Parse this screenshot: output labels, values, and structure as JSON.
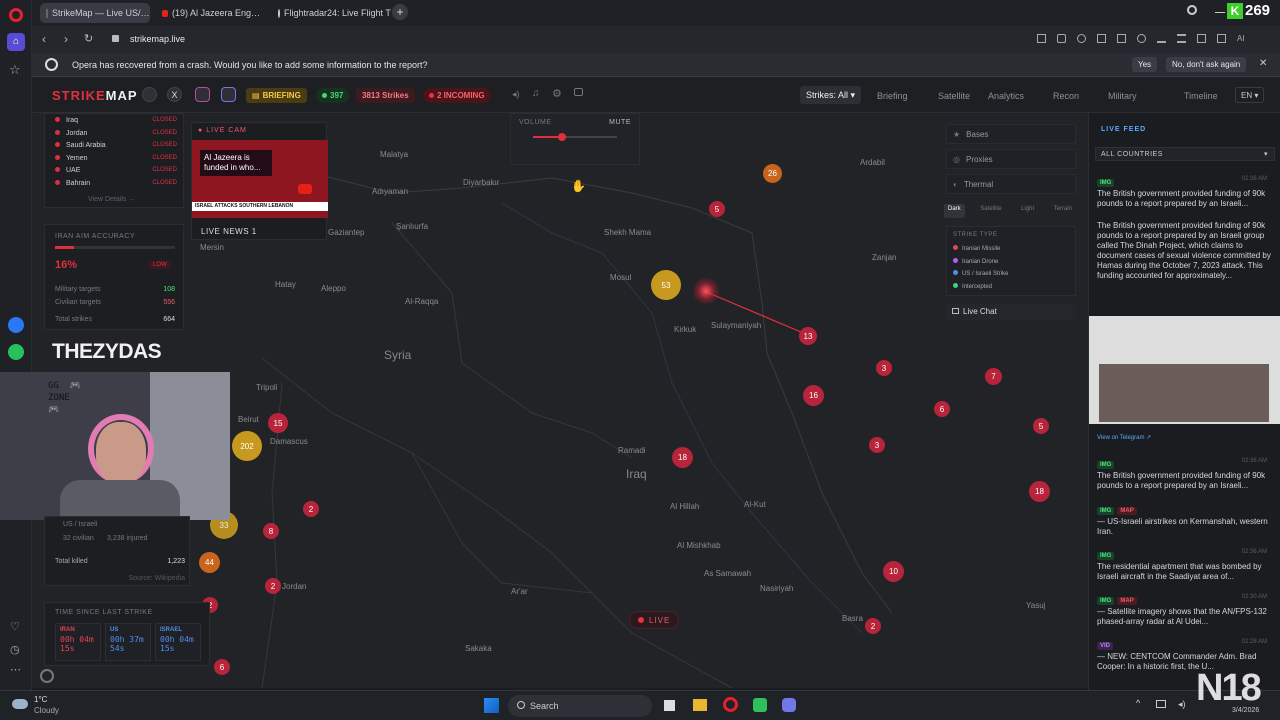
{
  "browser": {
    "tabs": [
      "StrikeMap — Live US/…",
      "(19) Al Jazeera Eng…",
      "Flightradar24: Live Flight T…"
    ],
    "url": "strikemap.live",
    "crash_message": "Opera has recovered from a crash. Would you like to add some information to the report?",
    "crash_yes": "Yes",
    "crash_no": "No, don't ask again",
    "badge_count": "269"
  },
  "header": {
    "logo_a": "STRIKE",
    "logo_b": "MAP",
    "briefing": "BRIEFING",
    "online_count": "397",
    "strikes_count": "3813 Strikes",
    "incoming": "2 INCOMING",
    "nav": [
      "Strikes: All",
      "Briefing",
      "Satellite",
      "Analytics",
      "Recon",
      "Military",
      "Timeline"
    ],
    "lang": "EN"
  },
  "countries_list": [
    {
      "name": "Iraq",
      "status": "CLOSED"
    },
    {
      "name": "Jordan",
      "status": "CLOSED"
    },
    {
      "name": "Saudi Arabia",
      "status": "CLOSED"
    },
    {
      "name": "Yemen",
      "status": "CLOSED"
    },
    {
      "name": "UAE",
      "status": "CLOSED"
    },
    {
      "name": "Bahrain",
      "status": "CLOSED"
    }
  ],
  "view_details": "View Details →",
  "accuracy": {
    "title": "IRAN AIM ACCURACY",
    "percent": "16%",
    "rating": "LOW",
    "military_label": "Military targets",
    "military": "108",
    "civilian_label": "Civilian targets",
    "civilian": "556",
    "total_label": "Total strikes",
    "total": "664",
    "fill": 0.16
  },
  "watermark": "THEZYDAS",
  "casualties": {
    "us_israel": "US / Israeli",
    "civilian": "32 civilian",
    "injured": "3,238 injured",
    "killed_label": "Total killed",
    "killed": "1,223",
    "source": "Source: Wikipedia"
  },
  "timers": {
    "title": "TIME SINCE LAST STRIKE",
    "items": [
      {
        "label": "IRAN",
        "line1": "00h 04m",
        "line2": "15s",
        "color": "#e2454f"
      },
      {
        "label": "US",
        "line1": "00h 37m",
        "line2": "54s",
        "color": "#4f8fe8"
      },
      {
        "label": "ISRAEL",
        "line1": "00h 04m",
        "line2": "15s",
        "color": "#4f8fe8"
      }
    ]
  },
  "live_cam": {
    "label": "LIVE CAM",
    "headline": "Al Jazeera is funded in who...",
    "ticker": "ISRAEL ATTACKS SOUTHERN LEBANON",
    "news": "LIVE NEWS 1"
  },
  "volume": {
    "label": "VOLUME",
    "mute": "MUTE",
    "level": 0.3
  },
  "map": {
    "countries": [
      "Syria",
      "Iraq"
    ],
    "cities": [
      "Malatya",
      "Adıyaman",
      "Diyarbakır",
      "Ardabil",
      "Şanlıurfa",
      "Gaziantep",
      "Mersin",
      "Shekh Mama",
      "Zanjan",
      "Mosul",
      "Hatay",
      "Aleppo",
      "Al-Raqqa",
      "Kirkuk",
      "Sulaymaniyah",
      "Tripoli",
      "Beirut",
      "Damascus",
      "Ramadi",
      "Al Hillah",
      "Al-Kut",
      "Al Mishkhab",
      "As Samawah",
      "Nasiriyah",
      "Jordan",
      "Ar'ar",
      "Basra",
      "Sakaka",
      "Yasuj"
    ],
    "markers": [
      "26",
      "5",
      "53",
      "13",
      "3",
      "7",
      "16",
      "6",
      "15",
      "202",
      "3",
      "5",
      "18",
      "18",
      "2",
      "8",
      "2",
      "10",
      "44",
      "2",
      "6",
      "2",
      "33"
    ],
    "live": "LIVE"
  },
  "layers": {
    "items": [
      "Bases",
      "Proxies",
      "Thermal"
    ],
    "styles": [
      "Dark",
      "Satellite",
      "Light",
      "Terrain"
    ],
    "strike_type_title": "STRIKE TYPE",
    "strike_types": [
      {
        "name": "Iranian Missile",
        "color": "#e2454f"
      },
      {
        "name": "Iranian Drone",
        "color": "#b45ff0"
      },
      {
        "name": "US / Israeli Strike",
        "color": "#4f8fe8"
      },
      {
        "name": "Intercepted",
        "color": "#3ed07a"
      }
    ],
    "chat": "Live Chat"
  },
  "feed": {
    "title": "LIVE FEED",
    "filter": "ALL COUNTRIES",
    "times": [
      "02:36 AM",
      "02:36 AM",
      "02:36 AM",
      "02:30 AM",
      "02:28 AM"
    ],
    "short1": "The British government provided funding of 90k pounds to a report prepared by an Israeli...",
    "long1": "The British government provided funding of 90k pounds to a report prepared by an Israeli group called The Dinah Project, which claims to document cases of sexual violence committed by Hamas during the October 7, 2023 attack. This funding accounted for approximately...",
    "telegram": "View on Telegram ↗",
    "short2": "The British government provided funding of 90k pounds to a report prepared by an Israeli...",
    "item3": "— US-Israeli airstrikes on Kermanshah, western Iran.",
    "item4": "The residential apartment that was bombed by Israeli aircraft in the Saadiyat area of...",
    "item5": "— Satellite imagery shows that the AN/FPS-132 phased-array radar at Al Udei...",
    "item6": "— NEW: CENTCOM Commander Adm. Brad Cooper: In a historic first, the U...",
    "tags": [
      "IMG",
      "IMG",
      "IMG",
      "MAP",
      "IMG",
      "IMG",
      "MAP",
      "VID"
    ]
  },
  "taskbar": {
    "temp": "1°C",
    "weather": "Cloudy",
    "search": "Search",
    "date": "3/4/2026",
    "brand": "N18"
  }
}
